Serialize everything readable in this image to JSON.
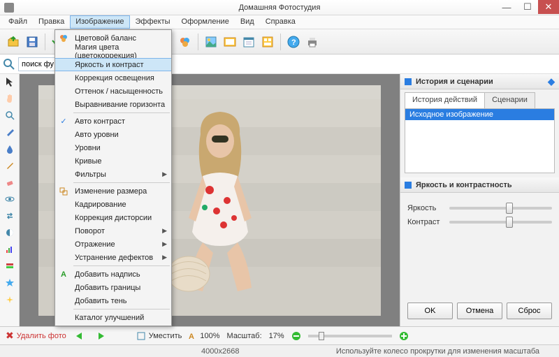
{
  "window": {
    "title": "Домашняя Фотостудия"
  },
  "menu": [
    "Файл",
    "Правка",
    "Изображение",
    "Эффекты",
    "Оформление",
    "Вид",
    "Справка"
  ],
  "active_menu": 2,
  "search": {
    "placeholder": "поиск фу"
  },
  "dropdown": {
    "items": [
      {
        "label": "Цветовой баланс",
        "icon": "palette"
      },
      {
        "label": "Магия цвета (цветокоррекция)"
      },
      {
        "label": "Яркость и контраст",
        "hi": true
      },
      {
        "label": "Коррекция освещения"
      },
      {
        "label": "Оттенок / насыщенность"
      },
      {
        "label": "Выравнивание горизонта"
      },
      {
        "sep": true
      },
      {
        "label": "Авто контраст",
        "icon": "check"
      },
      {
        "label": "Авто уровни"
      },
      {
        "label": "Уровни"
      },
      {
        "label": "Кривые"
      },
      {
        "label": "Фильтры",
        "sub": true
      },
      {
        "sep": true
      },
      {
        "label": "Изменение размера",
        "icon": "resize"
      },
      {
        "label": "Кадрирование"
      },
      {
        "label": "Коррекция дисторсии"
      },
      {
        "label": "Поворот",
        "sub": true
      },
      {
        "label": "Отражение",
        "sub": true
      },
      {
        "label": "Устранение дефектов",
        "sub": true
      },
      {
        "sep": true
      },
      {
        "label": "Добавить надпись",
        "icon": "text"
      },
      {
        "label": "Добавить границы"
      },
      {
        "label": "Добавить тень"
      },
      {
        "sep": true
      },
      {
        "label": "Каталог улучшений"
      }
    ]
  },
  "right": {
    "panel1_title": "История и сценарии",
    "tabs": [
      "История действий",
      "Сценарии"
    ],
    "history_item": "Исходное изображение",
    "panel2_title": "Яркость и контрастность",
    "slider1": "Яркость",
    "slider2": "Контраст",
    "btn_ok": "OK",
    "btn_cancel": "Отмена",
    "btn_reset": "Сброс"
  },
  "bottom": {
    "delete": "Удалить фото",
    "fit": "Уместить",
    "zoom_text": "100%",
    "scale_label": "Масштаб:",
    "scale_val": "17%"
  },
  "status": {
    "dims": "4000x2668",
    "hint": "Используйте колесо прокрутки для изменения масштаба"
  }
}
